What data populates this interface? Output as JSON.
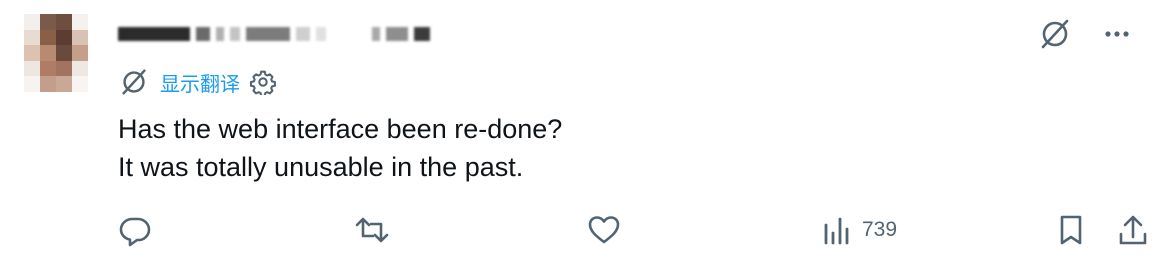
{
  "author": {
    "name": "redacted"
  },
  "translate": {
    "label": "显示翻译"
  },
  "tweet": {
    "lines": [
      "Has the web interface been re-done?",
      "It was totally unusable in the past."
    ]
  },
  "actions": {
    "views": "739"
  },
  "icons": {
    "grok": "slashed-circle-icon",
    "more": "more-icon",
    "settings": "gear-icon",
    "reply": "reply-icon",
    "retweet": "retweet-icon",
    "like": "heart-icon",
    "views": "analytics-icon",
    "bookmark": "bookmark-icon",
    "share": "share-icon"
  },
  "colors": {
    "accent": "#1d9bf0",
    "text": "#0f1419",
    "icon": "#536471"
  }
}
